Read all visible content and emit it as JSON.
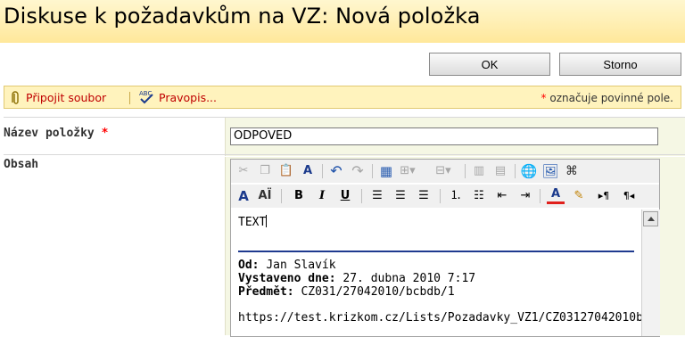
{
  "page": {
    "title": "Diskuse k požadavkům na VZ: Nová položka"
  },
  "actions": {
    "ok_label": "OK",
    "cancel_label": "Storno"
  },
  "toolbar": {
    "attach_label": "Připojit soubor",
    "spelling_label": "Pravopis...",
    "required_note_star": "*",
    "required_note_text": "označuje povinné pole."
  },
  "form": {
    "title_label": "Název položky",
    "required_star": "*",
    "title_value": "ODPOVED",
    "body_label": "Obsah"
  },
  "editor": {
    "first_line": "TEXT",
    "from_label": "Od:",
    "from_value": "Jan Slavík",
    "sent_label": "Vystaveno dne:",
    "sent_value": "27. dubna 2010 7:17",
    "subject_label": "Předmět:",
    "subject_value": "CZ031/27042010/bcbdb/1",
    "link": "https://test.krizkom.cz/Lists/Pozadavky_VZ1/CZ03127042010b"
  },
  "rte_icons": {
    "row1": [
      "cut-icon",
      "copy-icon",
      "paste-icon",
      "spell-style-icon",
      "undo-icon",
      "redo-icon",
      "table-icon",
      "insert-table-icon",
      "table-props-icon",
      "split-cell-icon",
      "merge-cell-icon",
      "hyperlink-icon",
      "image-icon",
      "source-icon"
    ],
    "row2": [
      "font-icon",
      "font-size-icon",
      "bold-icon",
      "italic-icon",
      "underline-icon",
      "align-left-icon",
      "align-center-icon",
      "align-right-icon",
      "numbered-list-icon",
      "bullet-list-icon",
      "outdent-icon",
      "indent-icon",
      "text-color-icon",
      "highlight-icon",
      "ltr-icon",
      "rtl-icon"
    ]
  }
}
